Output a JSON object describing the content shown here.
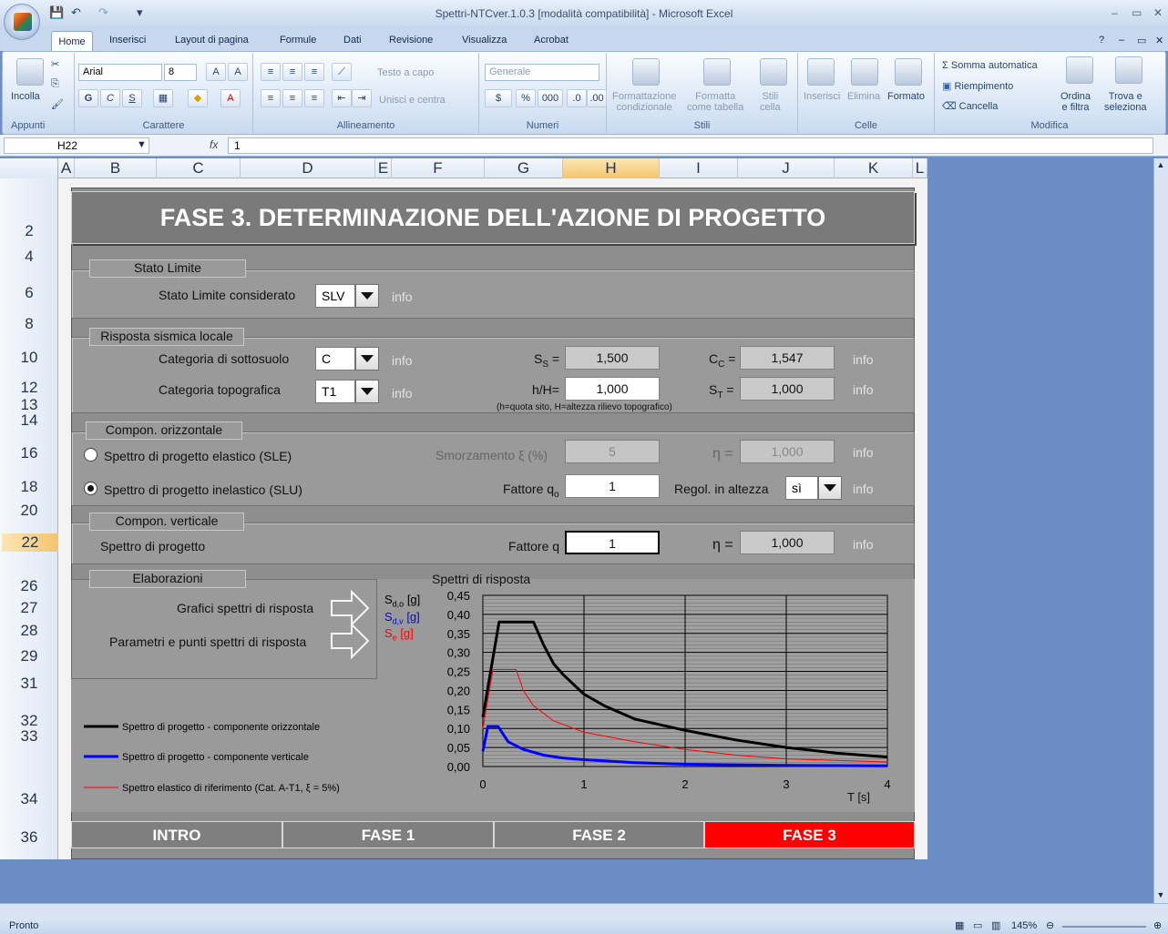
{
  "window": {
    "title": "Spettri-NTCver.1.0.3  [modalità compatibilità] - Microsoft Excel",
    "controls": [
      "–",
      "▭",
      "✕"
    ],
    "inner_controls": [
      "?",
      "–",
      "▭",
      "✕"
    ]
  },
  "ribbon_tabs": [
    "Home",
    "Inserisci",
    "Layout di pagina",
    "Formule",
    "Dati",
    "Revisione",
    "Visualizza",
    "Acrobat"
  ],
  "ribbon": {
    "appunti": {
      "label": "Appunti",
      "paste": "Incolla"
    },
    "carattere": {
      "label": "Carattere",
      "font": "Arial",
      "size": "8",
      "bold": "G",
      "italic": "C",
      "underline": "S"
    },
    "allineamento": {
      "label": "Allineamento",
      "wrap": "Testo a capo",
      "merge": "Unisci e centra"
    },
    "numeri": {
      "label": "Numeri",
      "format": "Generale",
      "percent": "%",
      "thousands": "000"
    },
    "stili": {
      "label": "Stili",
      "cond": "Formattazione\ncondizionale",
      "table": "Formatta\ncome tabella",
      "cell": "Stili\ncella"
    },
    "celle": {
      "label": "Celle",
      "insert": "Inserisci",
      "delete": "Elimina",
      "format": "Formato"
    },
    "modifica": {
      "label": "Modifica",
      "autosum": "Somma automatica",
      "fill": "Riempimento",
      "clear": "Cancella",
      "sort": "Ordina\ne filtra",
      "find": "Trova e\nseleziona"
    }
  },
  "formula_bar": {
    "name_box": "H22",
    "fx": "fx",
    "value": "1"
  },
  "columns": [
    "A",
    "B",
    "C",
    "D",
    "E",
    "F",
    "G",
    "H",
    "I",
    "J",
    "K",
    "L"
  ],
  "rows": [
    "2",
    "4",
    "6",
    "8",
    "10",
    "12",
    "13",
    "14",
    "16",
    "18",
    "20",
    "22",
    "26",
    "27",
    "28",
    "29",
    "31",
    "32",
    "33",
    "34",
    "36"
  ],
  "sheet": {
    "title": "FASE 3. DETERMINAZIONE DELL'AZIONE DI PROGETTO",
    "stato_limite": {
      "legend": "Stato Limite",
      "label": "Stato Limite considerato",
      "value": "SLV",
      "info": "info"
    },
    "risposta": {
      "legend": "Risposta sismica locale",
      "cat_sottosuolo_label": "Categoria di sottosuolo",
      "cat_sottosuolo_value": "C",
      "cat_topo_label": "Categoria topografica",
      "cat_topo_value": "T1",
      "info": "info",
      "ss_label": "S",
      "ss_sub": "S",
      "ss_value": "1,500",
      "cc_label": "C",
      "cc_sub": "C",
      "cc_value": "1,547",
      "hH_label": "h/H=",
      "hH_value": "1,000",
      "st_label": "S",
      "st_sub": "T",
      "st_value": "1,000",
      "note": "(h=quota sito, H=altezza rilievo topografico)"
    },
    "orizzontale": {
      "legend": "Compon. orizzontale",
      "sle_label": "Spettro di progetto elastico (SLE)",
      "slu_label": "Spettro di progetto inelastico (SLU)",
      "smorz_label": "Smorzamento",
      "smorz_symbol": "ξ (%)",
      "smorz_value": "5",
      "eta_symbol": "η =",
      "eta_value": "1,000",
      "fattore_label": "Fattore q",
      "fattore_sub": "o",
      "fattore_value": "1",
      "regol_label": "Regol. in altezza",
      "regol_value": "sì",
      "info": "info"
    },
    "verticale": {
      "legend": "Compon. verticale",
      "label": "Spettro di progetto",
      "fattore_label": "Fattore q",
      "fattore_value": "1",
      "eta_symbol": "η =",
      "eta_value": "1,000",
      "info": "info"
    },
    "elaborazioni": {
      "legend": "Elaborazioni",
      "grafici": "Grafici spettri di risposta",
      "parametri": "Parametri e punti spettri di risposta"
    },
    "legend_items": [
      {
        "label": "Spettro di progetto - componente orizzontale",
        "color": "#000000"
      },
      {
        "label": "Spettro di progetto - componente verticale",
        "color": "#0000ff"
      },
      {
        "label": "Spettro elastico di riferimento (Cat. A-T1, ξ = 5%)",
        "color": "#ff0000"
      }
    ],
    "nav": [
      "INTRO",
      "FASE 1",
      "FASE 2",
      "FASE 3"
    ]
  },
  "chart_data": {
    "type": "line",
    "title": "Spettri di risposta",
    "xlabel": "T [s]",
    "ylabels": [
      "S",
      "S",
      "S"
    ],
    "ylabel_subs": [
      "d,o",
      "d,v",
      "e"
    ],
    "ylabel_units": [
      "[g]",
      "[g]",
      "[g]"
    ],
    "ylabel_colors": [
      "#000000",
      "#0000ff",
      "#ff0000"
    ],
    "xlim": [
      0,
      4
    ],
    "ylim": [
      0,
      0.45
    ],
    "xticks": [
      "0",
      "1",
      "2",
      "3",
      "4"
    ],
    "yticks": [
      "0,00",
      "0,05",
      "0,10",
      "0,15",
      "0,20",
      "0,25",
      "0,30",
      "0,35",
      "0,40",
      "0,45"
    ],
    "series": [
      {
        "color": "#000000",
        "points": [
          [
            0,
            0.13
          ],
          [
            0.16,
            0.38
          ],
          [
            0.5,
            0.38
          ],
          [
            0.6,
            0.32
          ],
          [
            0.7,
            0.27
          ],
          [
            0.8,
            0.24
          ],
          [
            1.0,
            0.19
          ],
          [
            1.2,
            0.16
          ],
          [
            1.5,
            0.125
          ],
          [
            2.0,
            0.095
          ],
          [
            2.5,
            0.07
          ],
          [
            3.0,
            0.05
          ],
          [
            3.5,
            0.035
          ],
          [
            4.0,
            0.025
          ]
        ]
      },
      {
        "color": "#0000ff",
        "points": [
          [
            0,
            0.04
          ],
          [
            0.05,
            0.105
          ],
          [
            0.15,
            0.105
          ],
          [
            0.25,
            0.065
          ],
          [
            0.4,
            0.045
          ],
          [
            0.6,
            0.03
          ],
          [
            0.8,
            0.022
          ],
          [
            1.0,
            0.018
          ],
          [
            1.5,
            0.01
          ],
          [
            2.0,
            0.006
          ],
          [
            3.0,
            0.003
          ],
          [
            4.0,
            0.002
          ]
        ]
      },
      {
        "color": "#ff0000",
        "points": [
          [
            0,
            0.1
          ],
          [
            0.1,
            0.255
          ],
          [
            0.33,
            0.255
          ],
          [
            0.4,
            0.2
          ],
          [
            0.5,
            0.16
          ],
          [
            0.7,
            0.12
          ],
          [
            1.0,
            0.09
          ],
          [
            1.5,
            0.065
          ],
          [
            2.0,
            0.045
          ],
          [
            2.5,
            0.03
          ],
          [
            3.0,
            0.02
          ],
          [
            4.0,
            0.012
          ]
        ]
      }
    ]
  },
  "status": {
    "ready": "Pronto",
    "zoom": "145%"
  }
}
